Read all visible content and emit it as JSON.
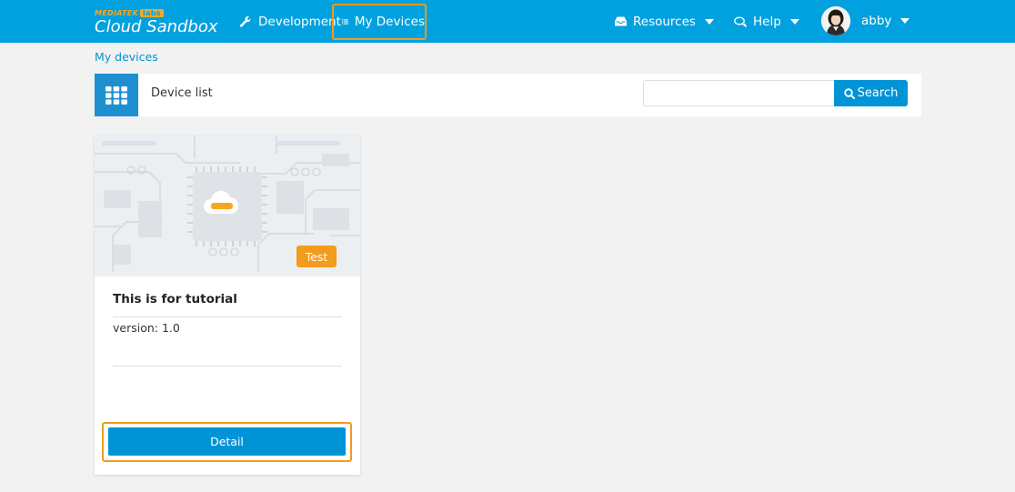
{
  "brand": {
    "company": "MEDIATEK",
    "labs": "labs",
    "product": "Cloud Sandbox"
  },
  "nav": {
    "development": "Development",
    "my_devices": "My Devices",
    "resources": "Resources",
    "help": "Help",
    "user": "abby"
  },
  "breadcrumb": "My devices",
  "list": {
    "title": "Device list",
    "search_placeholder": "",
    "search_label": "Search"
  },
  "device": {
    "badge": "Test",
    "name": "This is for tutorial",
    "version": "version: 1.0",
    "detail_label": "Detail"
  },
  "colors": {
    "navbar": "#00a1de",
    "accent_orange": "#f29b1d",
    "button_blue": "#0094d6",
    "page_bg": "#f2f2f2"
  },
  "icons": {
    "development": "wrench-icon",
    "my_devices": "list-icon",
    "resources": "inbox-icon",
    "help": "chat-icon",
    "search": "search-icon",
    "device_list": "grid-icon"
  }
}
